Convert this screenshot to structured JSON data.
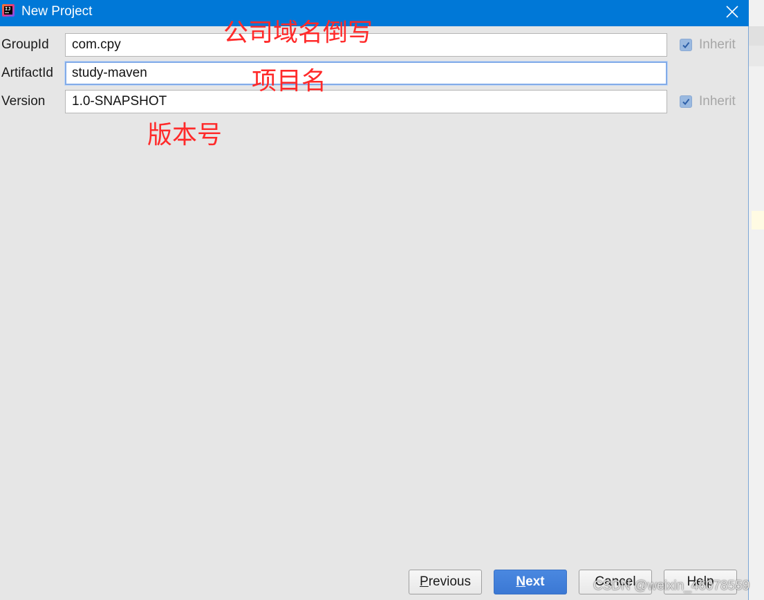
{
  "window": {
    "title": "New Project",
    "icon": "intellij-idea-icon",
    "close_icon": "close-icon"
  },
  "form": {
    "group_id": {
      "label": "GroupId",
      "value": "com.cpy",
      "inherit_label": "Inherit",
      "inherit_checked": true
    },
    "artifact_id": {
      "label": "ArtifactId",
      "value": "study-maven"
    },
    "version": {
      "label": "Version",
      "value": "1.0-SNAPSHOT",
      "inherit_label": "Inherit",
      "inherit_checked": true
    }
  },
  "annotations": {
    "group_note": "公司域名倒写",
    "artifact_note": "项目名",
    "version_note": "版本号",
    "color": "#ff2a2a"
  },
  "buttons": {
    "previous": {
      "mnemonic": "P",
      "rest": "revious"
    },
    "next": {
      "mnemonic": "N",
      "rest": "ext"
    },
    "cancel": {
      "label": "Cancel"
    },
    "help": {
      "label": "Help"
    }
  },
  "watermark": "CSDN @weixin_46078559",
  "colors": {
    "titlebar": "#0078d7",
    "dialog_bg": "#e6e6e6",
    "primary_button": "#3b78d4"
  }
}
